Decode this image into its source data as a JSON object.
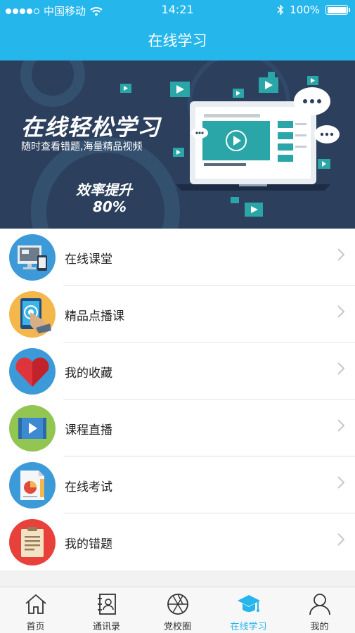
{
  "status_bar": {
    "carrier": "中国移动",
    "time": "14:21",
    "battery": "100%",
    "battery_level": 1.0
  },
  "nav": {
    "title": "在线学习"
  },
  "banner": {
    "title": "在线轻松学习",
    "subtitle": "随时查看错题,海量精品视频",
    "efficiency": "效率提升",
    "percent": "80%"
  },
  "menu": {
    "items": [
      {
        "label": "在线课堂",
        "icon": "computer-icon"
      },
      {
        "label": "精品点播课",
        "icon": "tablet-touch-icon"
      },
      {
        "label": "我的收藏",
        "icon": "heart-icon"
      },
      {
        "label": "课程直播",
        "icon": "video-play-icon"
      },
      {
        "label": "在线考试",
        "icon": "exam-chart-icon"
      },
      {
        "label": "我的错题",
        "icon": "clipboard-icon"
      }
    ]
  },
  "tabbar": {
    "items": [
      {
        "label": "首页",
        "icon": "home-icon"
      },
      {
        "label": "通讯录",
        "icon": "contacts-icon"
      },
      {
        "label": "党校圈",
        "icon": "aperture-icon"
      },
      {
        "label": "在线学习",
        "icon": "graduation-cap-icon",
        "active": true
      },
      {
        "label": "我的",
        "icon": "user-icon"
      }
    ]
  },
  "colors": {
    "primary": "#25b6ec",
    "banner_bg": "#2c3f5d"
  }
}
